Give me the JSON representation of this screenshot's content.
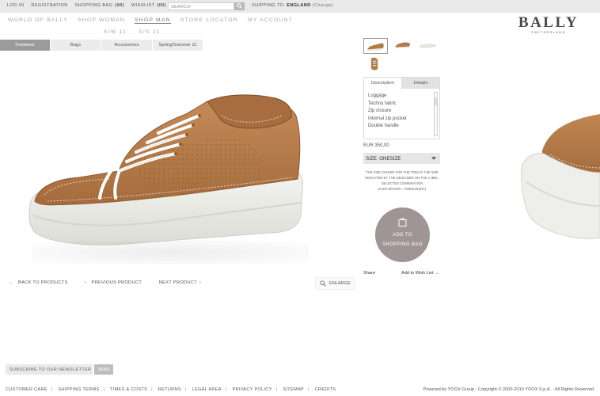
{
  "topbar": {
    "login": "LOG IN",
    "registration": "REGISTRATION",
    "shopping_bag": "SHOPPING BAG",
    "shopping_bag_count": "(00)",
    "wishlist": "WISHLIST",
    "wishlist_count": "(00)",
    "search_placeholder": "SEARCH",
    "shipping_label": "SHIPPING TO:",
    "shipping_country": "ENGLAND",
    "shipping_change": "(Change)"
  },
  "mainnav": {
    "items": [
      {
        "label": "WORLD OF BALLY"
      },
      {
        "label": "SHOP WOMAN"
      },
      {
        "label": "SHOP MAN"
      },
      {
        "label": "STORE LOCATOR"
      },
      {
        "label": "MY ACCOUNT"
      }
    ],
    "active": "SHOP MAN"
  },
  "subnav": {
    "items": [
      {
        "label": "A/W 11"
      },
      {
        "label": "S/S 11"
      }
    ]
  },
  "logo": {
    "brand": "BALLY",
    "sub": "SWITZERLAND"
  },
  "category_tabs": [
    {
      "label": "Footwear"
    },
    {
      "label": "Bags"
    },
    {
      "label": "Accessories"
    },
    {
      "label": "Spring/Summer 11"
    }
  ],
  "product_nav": {
    "back": "BACK TO PRODUCTS",
    "previous": "PREVIOUS PRODUCT",
    "next": "NEXT PRODUCT",
    "enlarge": "ENLARGE"
  },
  "description": {
    "tab_description": "Description",
    "tab_details": "Details",
    "items": [
      "Luggage",
      "Techno fabric",
      "Zip closure",
      "Internal zip pocket",
      "Double handle"
    ]
  },
  "price": "EUR 350,00",
  "size_label": "SIZE: ONESIZE",
  "size_note_1": "THE SIZE SHOWN FOR THE ITEM IS THE SIZE",
  "size_note_2": "INDICATED BY THE DESIGNER ON THE LABEL.",
  "size_note_3": "SELECTED COMBINATION",
  "size_note_4": "DARK BROWN - ONESIZE(INT)",
  "add_to_bag": {
    "line1": "ADD TO",
    "line2": "SHOPPING BAG"
  },
  "share": "Share",
  "add_to_wishlist": "Add to Wish List",
  "newsletter": {
    "placeholder": "SUBSCRIBE TO OUR NEWSLETTER",
    "send": "SEND"
  },
  "footer": {
    "links": [
      "CUSTOMER CARE",
      "SHIPPING TERMS",
      "TIMES & COSTS",
      "RETURNS",
      "LEGAL AREA",
      "PRIVACY POLICY",
      "SITEMAP",
      "CREDITS"
    ],
    "copyright": "Powered by YOOX Group - Copyright © 2000-2010 YOOX S.p.A. - All Rights Reserved"
  },
  "colors": {
    "topbar_bg": "#e9e9e9",
    "active_tab": "#9b9b9b",
    "add_to_bag": "#9f9595",
    "shoe_leather": "#b47a47",
    "sole": "#eeeeea"
  },
  "icons": {
    "search": "search-icon",
    "back_arrow": "arrow-left-icon",
    "prev_arrow": "chevron-left-icon",
    "next_arrow": "chevron-right-icon",
    "enlarge": "magnifier-icon",
    "bag": "shopping-bag-icon",
    "wishlist_arrow": "arrow-right-icon",
    "dropdown": "caret-down-icon"
  }
}
